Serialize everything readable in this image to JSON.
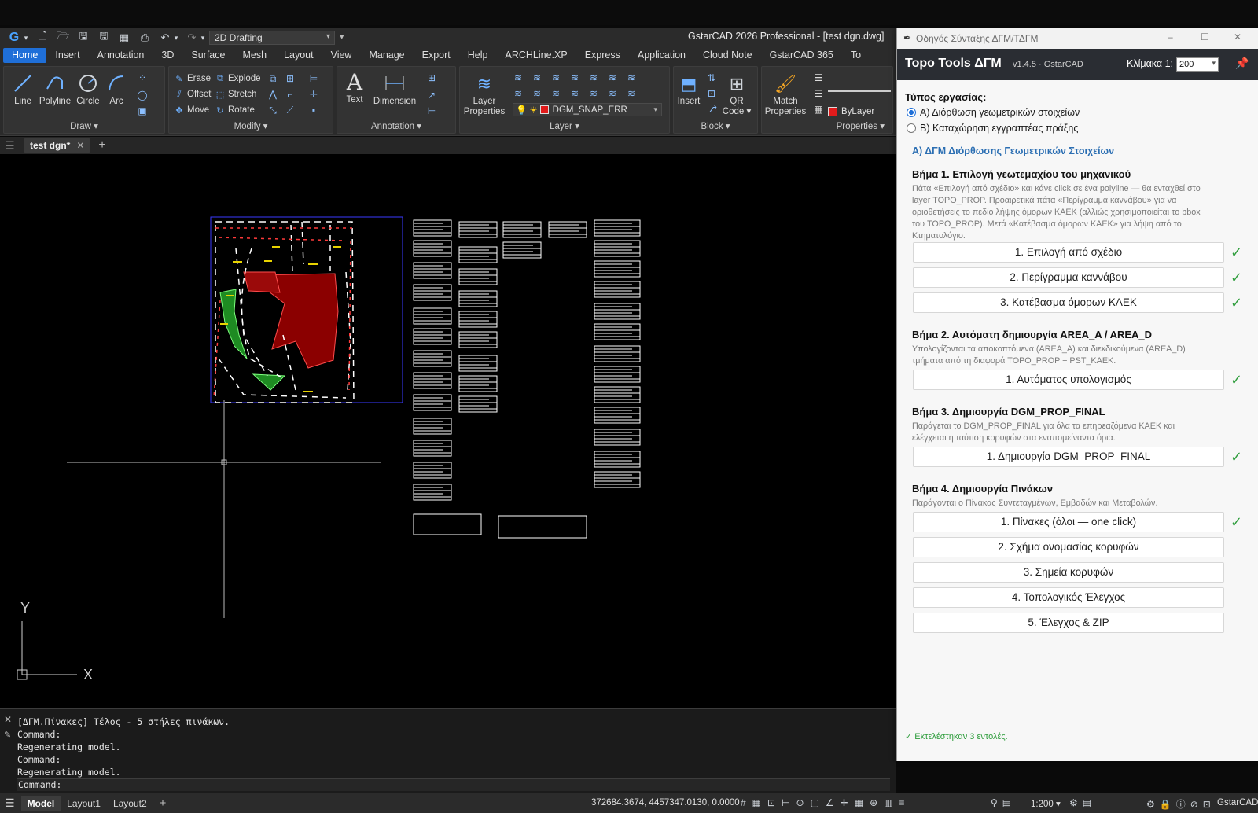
{
  "window": {
    "title": "GstarCAD 2026 Professional - [test dgn.dwg]",
    "workspace": "2D Drafting"
  },
  "menu": {
    "items": [
      "Home",
      "Insert",
      "Annotation",
      "3D",
      "Surface",
      "Mesh",
      "Layout",
      "View",
      "Manage",
      "Export",
      "Help",
      "ARCHLine.XP",
      "Express",
      "Application",
      "Cloud Note",
      "GstarCAD 365",
      "To"
    ],
    "active": "Home"
  },
  "ribbon": {
    "draw": {
      "title": "Draw ▾",
      "line": "Line",
      "polyline": "Polyline",
      "circle": "Circle",
      "arc": "Arc"
    },
    "modify": {
      "title": "Modify ▾",
      "erase": "Erase",
      "explode": "Explode",
      "offset": "Offset",
      "stretch": "Stretch",
      "move": "Move",
      "rotate": "Rotate"
    },
    "annotation": {
      "title": "Annotation ▾",
      "text": "Text",
      "dimension": "Dimension"
    },
    "layer": {
      "title": "Layer ▾",
      "properties": "Layer\nProperties",
      "current": "DGM_SNAP_ERR",
      "current_color": "#e11b1b"
    },
    "block": {
      "title": "Block ▾",
      "insert": "Insert",
      "qr": "QR\nCode ▾"
    },
    "properties": {
      "title": "Properties ▾",
      "match": "Match\nProperties",
      "color": "ByLayer"
    }
  },
  "doc_tab": "test dgn*",
  "command": {
    "lines": [
      "[ΔΓΜ.Πίνακες] Τέλος - 5 στήλες πινάκων.",
      "Command:",
      "Regenerating model.",
      "Command:",
      "Regenerating model."
    ],
    "prompt": "Command:"
  },
  "status": {
    "layouts": [
      "Model",
      "Layout1",
      "Layout2"
    ],
    "coords": "372684.3674, 4457347.0130, 0.0000",
    "scale": "1:200 ▾",
    "brand": "GstarCAD"
  },
  "ucs": {
    "y": "Y",
    "x": "X"
  },
  "panel": {
    "window_title": "Οδηγός Σύνταξης ΔΓΜ/ΤΔΓΜ",
    "title": "Topo Tools ΔΓΜ",
    "version": "v1.4.5 · GstarCAD",
    "scale_label": "Κλίμακα 1:",
    "scale_value": "200",
    "work_type_label": "Τύπος εργασίας:",
    "options": [
      "Α) Διόρθωση γεωμετρικών στοιχείων",
      "Β) Καταχώρηση εγγραπτέας πράξης"
    ],
    "selected_option": 0,
    "section_title": "Α) ΔΓΜ Διόρθωσης Γεωμετρικών Στοιχείων",
    "step1": {
      "head": "Βήμα 1.  Επιλογή γεωτεμαχίου του μηχανικού",
      "desc": "Πάτα «Επιλογή από σχέδιο» και κάνε click σε ένα polyline — θα ενταχθεί στο layer TOPO_PROP. Προαιρετικά πάτα «Περίγραμμα καννάβου» για να οριοθετήσεις το πεδίο λήψης όμορων ΚΑΕΚ (αλλιώς χρησιμοποιείται το bbox του TOPO_PROP). Μετά «Κατέβασμα όμορων ΚΑΕΚ» για λήψη από το Κτηματολόγιο.",
      "buttons": [
        "1. Επιλογή από σχέδιο",
        "2. Περίγραμμα καννάβου",
        "3. Κατέβασμα όμορων ΚΑΕΚ"
      ]
    },
    "step2": {
      "head": "Βήμα 2.  Αυτόματη δημιουργία AREA_A / AREA_D",
      "desc": "Υπολογίζονται τα αποκοπτόμενα (AREA_A) και διεκδικούμενα (AREA_D) τμήματα από τη διαφορά TOPO_PROP − PST_KAEK.",
      "buttons": [
        "1. Αυτόματος υπολογισμός"
      ]
    },
    "step3": {
      "head": "Βήμα 3.  Δημιουργία DGM_PROP_FINAL",
      "desc": "Παράγεται το DGM_PROP_FINAL για όλα τα επηρεαζόμενα ΚΑΕΚ και ελέγχεται η ταύτιση κορυφών στα εναπομείναντα όρια.",
      "buttons": [
        "1. Δημιουργία DGM_PROP_FINAL"
      ]
    },
    "step4": {
      "head": "Βήμα 4.  Δημιουργία Πινάκων",
      "desc": "Παράγονται ο Πίνακας Συντεταγμένων, Εμβαδών και Μεταβολών.",
      "buttons": [
        "1. Πίνακες (όλοι — one click)",
        "2. Σχήμα ονομασίας κορυφών",
        "3. Σημεία κορυφών",
        "4. Τοπολογικός Έλεγχος",
        "5. Έλεγχος & ZIP"
      ]
    },
    "check_glyph": "✓",
    "footer": "✓ Εκτελέστηκαν 3 εντολές.",
    "colors": {
      "accent": "#1f6fd8",
      "check": "#2e9d3c",
      "header": "#2a2d33",
      "section": "#2c6fb3"
    }
  }
}
